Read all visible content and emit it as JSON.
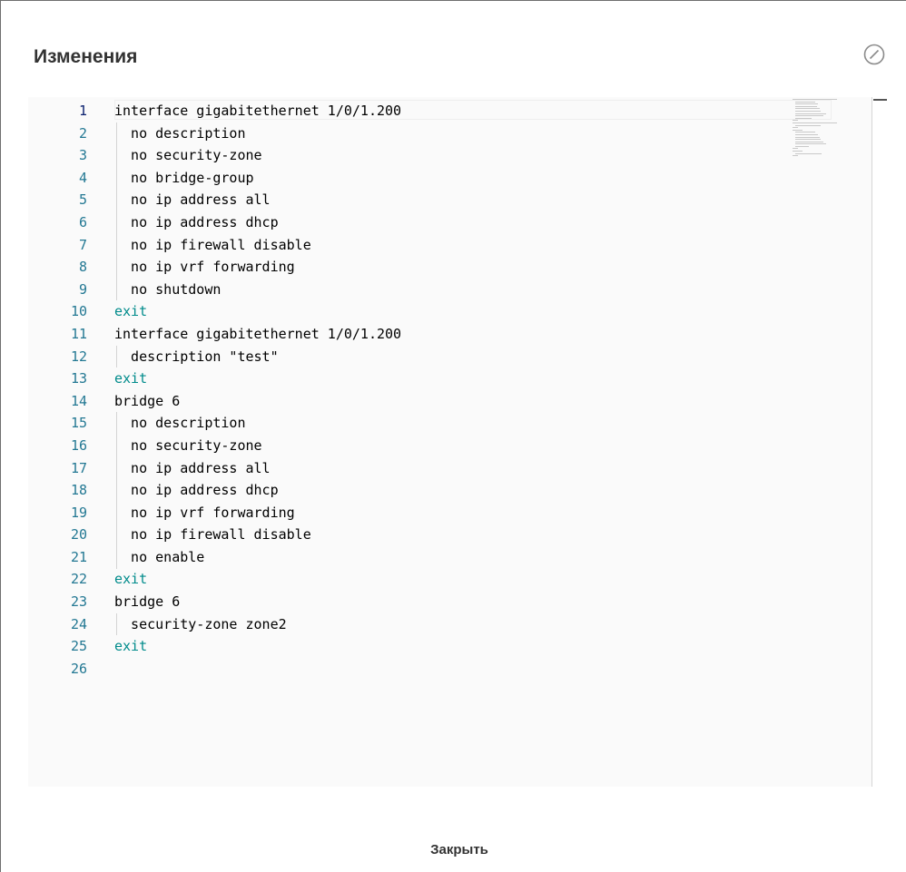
{
  "dialog": {
    "title": "Изменения",
    "edit_icon": "edit-disabled-icon",
    "close_label": "Закрыть"
  },
  "editor": {
    "line_numbers": [
      "1",
      "2",
      "3",
      "4",
      "5",
      "6",
      "7",
      "8",
      "9",
      "10",
      "11",
      "12",
      "13",
      "14",
      "15",
      "16",
      "17",
      "18",
      "19",
      "20",
      "21",
      "22",
      "23",
      "24",
      "25",
      "26"
    ],
    "lines": [
      "interface gigabitethernet 1/0/1.200",
      "  no description",
      "  no security-zone",
      "  no bridge-group",
      "  no ip address all",
      "  no ip address dhcp",
      "  no ip firewall disable",
      "  no ip vrf forwarding",
      "  no shutdown",
      "exit",
      "interface gigabitethernet 1/0/1.200",
      "  description \"test\"",
      "exit",
      "bridge 6",
      "  no description",
      "  no security-zone",
      "  no ip address all",
      "  no ip address dhcp",
      "  no ip vrf forwarding",
      "  no ip firewall disable",
      "  no enable",
      "exit",
      "bridge 6",
      "  security-zone zone2",
      "exit",
      ""
    ],
    "colors": {
      "line_number": "#237893",
      "keyword_exit": "#008b8b",
      "text": "#000000"
    }
  }
}
